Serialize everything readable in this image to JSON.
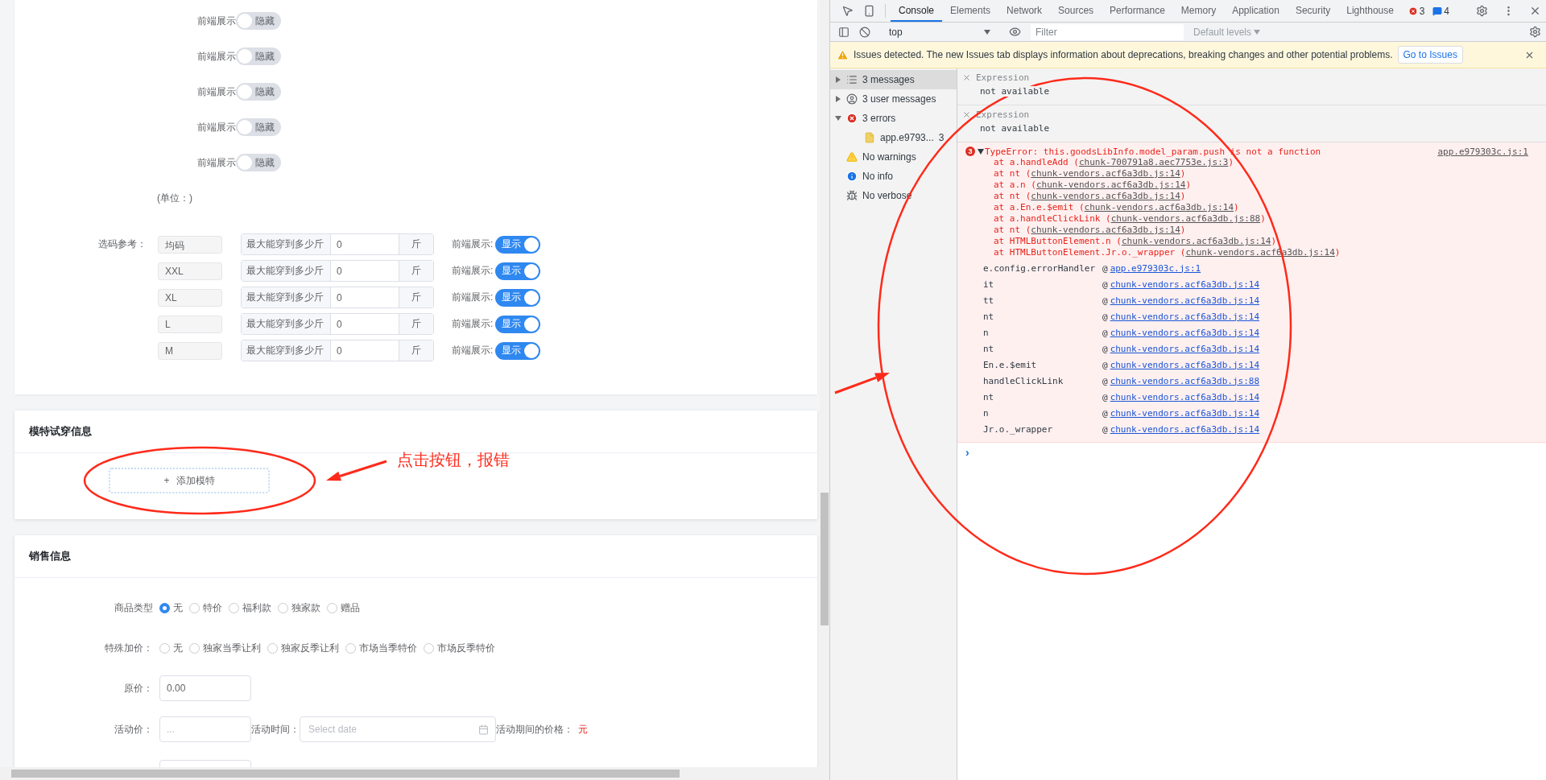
{
  "form": {
    "display_rows": [
      {
        "label": "前端展示",
        "on": false,
        "toggle_text": "隐藏"
      },
      {
        "label": "前端展示",
        "on": false,
        "toggle_text": "隐藏"
      },
      {
        "label": "前端展示",
        "on": false,
        "toggle_text": "隐藏"
      },
      {
        "label": "前端展示",
        "on": false,
        "toggle_text": "隐藏"
      },
      {
        "label": "前端展示",
        "on": false,
        "toggle_text": "隐藏"
      }
    ],
    "unit_note": "(单位：)",
    "size_ref": {
      "label": "选码参考：",
      "rows": [
        {
          "size": "均码",
          "prepend": "最大能穿到多少斤",
          "value": "0",
          "append": "斤",
          "display_label": "前端展示:",
          "on": true,
          "toggle_text": "显示"
        },
        {
          "size": "XXL",
          "prepend": "最大能穿到多少斤",
          "value": "0",
          "append": "斤",
          "display_label": "前端展示:",
          "on": true,
          "toggle_text": "显示"
        },
        {
          "size": "XL",
          "prepend": "最大能穿到多少斤",
          "value": "0",
          "append": "斤",
          "display_label": "前端展示:",
          "on": true,
          "toggle_text": "显示"
        },
        {
          "size": "L",
          "prepend": "最大能穿到多少斤",
          "value": "0",
          "append": "斤",
          "display_label": "前端展示:",
          "on": true,
          "toggle_text": "显示"
        },
        {
          "size": "M",
          "prepend": "最大能穿到多少斤",
          "value": "0",
          "append": "斤",
          "display_label": "前端展示:",
          "on": true,
          "toggle_text": "显示"
        }
      ]
    }
  },
  "model_card": {
    "title": "模特试穿信息",
    "add_button": {
      "icon": "+",
      "label": "添加模特"
    }
  },
  "sales_card": {
    "title": "销售信息",
    "goods_type": {
      "label": "商品类型",
      "options": [
        {
          "label": "无",
          "selected": true
        },
        {
          "label": "特价",
          "selected": false
        },
        {
          "label": "福利款",
          "selected": false
        },
        {
          "label": "独家款",
          "selected": false
        },
        {
          "label": "赠品",
          "selected": false
        }
      ]
    },
    "special": {
      "label": "特殊加价：",
      "options": [
        {
          "label": "无",
          "selected": false
        },
        {
          "label": "独家当季让利",
          "selected": false
        },
        {
          "label": "独家反季让利",
          "selected": false
        },
        {
          "label": "市场当季特价",
          "selected": false
        },
        {
          "label": "市场反季特价",
          "selected": false
        }
      ]
    },
    "original_price": {
      "label": "原价：",
      "value": "0.00"
    },
    "activity": {
      "label": "活动价：",
      "placeholder": "...",
      "time_label": "活动时间：",
      "date_placeholder": "Select date",
      "period_label": "活动期间的价格：",
      "period_value": "元"
    }
  },
  "annotation": {
    "note": "点击按钮，报错"
  },
  "devtools": {
    "tabs": [
      {
        "label": "Console",
        "selected": true
      },
      {
        "label": "Elements",
        "selected": false
      },
      {
        "label": "Network",
        "selected": false
      },
      {
        "label": "Sources",
        "selected": false
      },
      {
        "label": "Performance",
        "selected": false
      },
      {
        "label": "Memory",
        "selected": false
      },
      {
        "label": "Application",
        "selected": false
      },
      {
        "label": "Security",
        "selected": false
      },
      {
        "label": "Lighthouse",
        "selected": false
      }
    ],
    "error_count": "3",
    "message_count": "4",
    "toolbar": {
      "context": "top",
      "filter_placeholder": "Filter",
      "levels": "Default levels"
    },
    "issues_banner": {
      "text": "Issues detected. The new Issues tab displays information about deprecations, breaking changes and other potential problems.",
      "button": "Go to Issues"
    },
    "sidebar": [
      {
        "kind": "messages",
        "label": "3 messages",
        "expanded": false,
        "selected": true
      },
      {
        "kind": "user",
        "label": "3 user messages",
        "expanded": false,
        "selected": false
      },
      {
        "kind": "errors",
        "label": "3 errors",
        "expanded": true,
        "selected": false,
        "children": [
          {
            "kind": "file",
            "label": "app.e9793...",
            "count": "3",
            "selected": false
          }
        ]
      },
      {
        "kind": "warnings",
        "label": "No warnings",
        "selected": false
      },
      {
        "kind": "info",
        "label": "No info",
        "selected": false
      },
      {
        "kind": "verbose",
        "label": "No verbose",
        "selected": false
      }
    ],
    "expressions": [
      {
        "label": "Expression",
        "value": "not available"
      },
      {
        "label": "Expression",
        "value": "not available"
      }
    ],
    "error": {
      "count": "3",
      "message": "TypeError: this.goodsLibInfo.model_param.push is not a function",
      "source": "app.e979303c.js:1",
      "stack": [
        {
          "before": "at a.handleAdd (",
          "link": "chunk-700791a8.aec7753e.js:3",
          "after": ")"
        },
        {
          "before": "at nt (",
          "link": "chunk-vendors.acf6a3db.js:14",
          "after": ")"
        },
        {
          "before": "at a.n (",
          "link": "chunk-vendors.acf6a3db.js:14",
          "after": ")"
        },
        {
          "before": "at nt (",
          "link": "chunk-vendors.acf6a3db.js:14",
          "after": ")"
        },
        {
          "before": "at a.En.e.$emit (",
          "link": "chunk-vendors.acf6a3db.js:14",
          "after": ")"
        },
        {
          "before": "at a.handleClickLink (",
          "link": "chunk-vendors.acf6a3db.js:88",
          "after": ")"
        },
        {
          "before": "at nt (",
          "link": "chunk-vendors.acf6a3db.js:14",
          "after": ")"
        },
        {
          "before": "at HTMLButtonElement.n (",
          "link": "chunk-vendors.acf6a3db.js:14",
          "after": ")"
        },
        {
          "before": "at HTMLButtonElement.Jr.o._wrapper (",
          "link": "chunk-vendors.acf6a3db.js:14",
          "after": ")"
        }
      ],
      "trace": [
        {
          "fn": "e.config.errorHandler",
          "sep": "@",
          "link": "app.e979303c.js:1"
        },
        {
          "fn": "it",
          "sep": "@",
          "link": "chunk-vendors.acf6a3db.js:14"
        },
        {
          "fn": "tt",
          "sep": "@",
          "link": "chunk-vendors.acf6a3db.js:14"
        },
        {
          "fn": "nt",
          "sep": "@",
          "link": "chunk-vendors.acf6a3db.js:14"
        },
        {
          "fn": "n",
          "sep": "@",
          "link": "chunk-vendors.acf6a3db.js:14"
        },
        {
          "fn": "nt",
          "sep": "@",
          "link": "chunk-vendors.acf6a3db.js:14"
        },
        {
          "fn": "En.e.$emit",
          "sep": "@",
          "link": "chunk-vendors.acf6a3db.js:14"
        },
        {
          "fn": "handleClickLink",
          "sep": "@",
          "link": "chunk-vendors.acf6a3db.js:88"
        },
        {
          "fn": "nt",
          "sep": "@",
          "link": "chunk-vendors.acf6a3db.js:14"
        },
        {
          "fn": "n",
          "sep": "@",
          "link": "chunk-vendors.acf6a3db.js:14"
        },
        {
          "fn": "Jr.o._wrapper",
          "sep": "@",
          "link": "chunk-vendors.acf6a3db.js:14"
        }
      ]
    },
    "prompt": "›"
  }
}
